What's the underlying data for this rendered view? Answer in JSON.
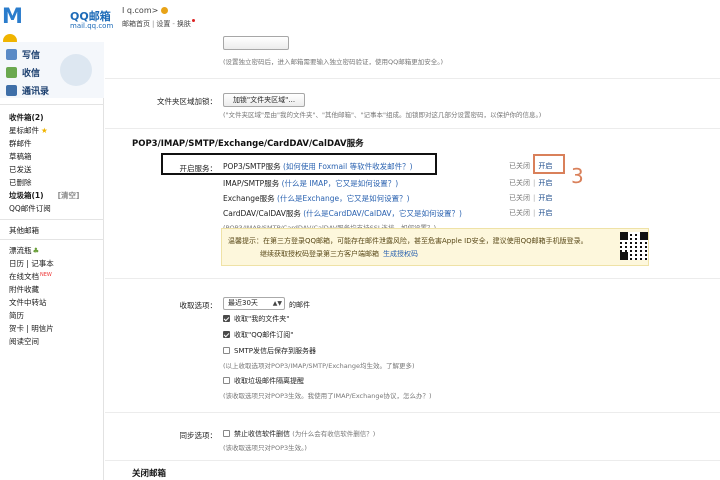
{
  "header": {
    "logo_text": "M   il",
    "logo_brand": "QQ邮箱",
    "logo_domain": "mail.qq.com",
    "user_email": "I        q.com>",
    "links": [
      "邮箱首页",
      "设置",
      "换肤"
    ]
  },
  "sidebar": {
    "compose": "写信",
    "inbox": "收信",
    "contacts": "通讯录",
    "folders": [
      {
        "label": "收件箱(2)",
        "bold": true
      },
      {
        "label": "星标邮件",
        "star": true
      },
      {
        "label": "群邮件"
      },
      {
        "label": "草稿箱"
      },
      {
        "label": "已发送"
      },
      {
        "label": "已删除"
      },
      {
        "label": "垃圾箱(1)",
        "bold": true,
        "aux": "[清空]"
      },
      {
        "label": "QQ邮件订阅"
      }
    ],
    "other_mailboxes": "其他邮箱",
    "apps": [
      {
        "label": "漂流瓶",
        "leaf": true
      },
      {
        "label": "日历 | 记事本"
      },
      {
        "label": "在线文档",
        "badge": "NEW"
      },
      {
        "label": "附件收藏"
      },
      {
        "label": "文件中转站"
      },
      {
        "label": "简历"
      },
      {
        "label": "贺卡 | 明信片"
      },
      {
        "label": "阅读空间"
      }
    ]
  },
  "main": {
    "top_hint": "(设置独立密码后，进入邮箱需要输入独立密码验证，使用QQ邮箱更加安全。)",
    "folder_label": "文件夹区域加锁：",
    "folder_button": "加锁\"文件夹区域\"...",
    "folder_hint": "(\"文件夹区域\"是由\"我的文件夹\"、\"其他邮箱\"、\"记事本\"组成。加锁即对这几部分设置密码，以保护你的信息。)",
    "section_title": "POP3/IMAP/SMTP/Exchange/CardDAV/CalDAV服务",
    "service_label": "开启服务：",
    "services": [
      {
        "name": "POP3/SMTP服务",
        "help": "(如何使用 Foxmail 等软件收发邮件？)",
        "state": "已关闭",
        "action": "开启"
      },
      {
        "name": "IMAP/SMTP服务",
        "help": "(什么是 IMAP，它又是如何设置？)",
        "state": "已关闭",
        "action": "开启"
      },
      {
        "name": "Exchange服务",
        "help": "(什么是Exchange，它又是如何设置？)",
        "state": "已关闭",
        "action": "开启"
      },
      {
        "name": "CardDAV/CalDAV服务",
        "help": "(什么是CardDAV/CalDAV，它又是如何设置？)",
        "state": "已关闭",
        "action": "开启"
      }
    ],
    "ssl_hint": "(POP3/IMAP/SMTP/CardDAV/CalDAV服务均支持SSL连接。如何设置？)",
    "notice_line1": "温馨提示：在第三方登录QQ邮箱，可能存在邮件泄露风险，甚至危害Apple ID安全，建议使用QQ邮箱手机版登录。",
    "notice_line2": "继续获取授权码登录第三方客户端邮箱",
    "notice_link": "生成授权码",
    "step_number": "3",
    "receive_label": "收取选项：",
    "receive_select": "最近30天",
    "receive_suffix": "的邮件",
    "receive_options": [
      {
        "label": "收取\"我的文件夹\"",
        "checked": true
      },
      {
        "label": "收取\"QQ邮件订阅\"",
        "checked": true
      },
      {
        "label": "SMTP发信后保存到服务器",
        "checked": false
      }
    ],
    "receive_hint1": "(以上收取选项对POP3/IMAP/SMTP/Exchange均生效。了解更多)",
    "receive_option_spam": "收取垃圾邮件隔离提醒",
    "receive_hint2": "(该收取选项只对POP3生效。我使用了IMAP/Exchange协议，怎么办？)",
    "sync_label": "同步选项：",
    "sync_option": "禁止收信软件删信",
    "sync_help": "(为什么会有收信软件删信？)",
    "sync_hint": "(该收取选项只对POP3生效。)",
    "close_mailbox": "关闭邮箱"
  },
  "colors": {
    "brand": "#2a7ccc",
    "link": "#2a62b0",
    "annotation": "#d9805a"
  }
}
